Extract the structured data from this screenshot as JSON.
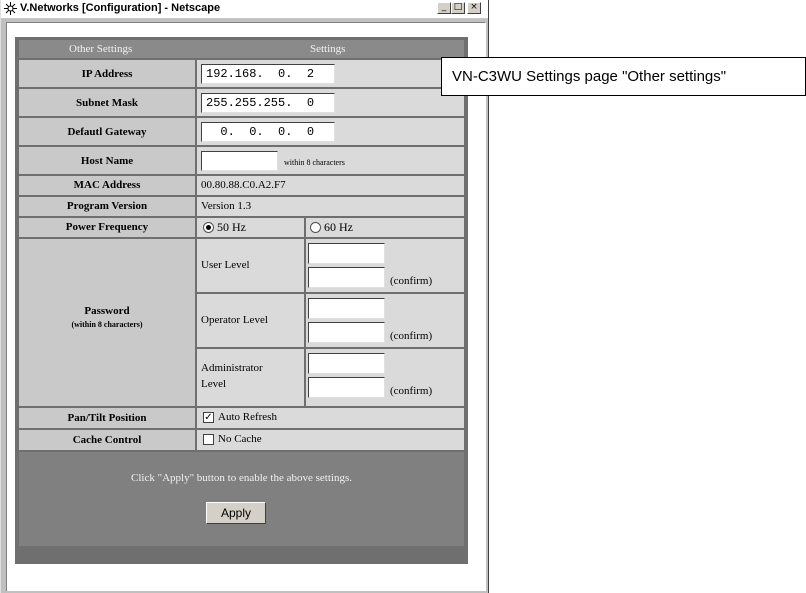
{
  "window": {
    "title": "V.Networks [Configuration] - Netscape",
    "controls": {
      "minimize": "_",
      "maximize": "□",
      "close": "×"
    }
  },
  "table": {
    "header": {
      "left": "Other Settings",
      "right": "Settings"
    },
    "ip_address": {
      "label": "IP Address",
      "value": "192.168.  0.  2"
    },
    "subnet_mask": {
      "label": "Subnet Mask",
      "value": "255.255.255.  0"
    },
    "default_gateway": {
      "label": "Defautl Gateway",
      "value": "  0.  0.  0.  0"
    },
    "host_name": {
      "label": "Host Name",
      "value": "",
      "hint": "within 8 characters"
    },
    "mac_address": {
      "label": "MAC Address",
      "value": "00.80.88.C0.A2.F7"
    },
    "program_version": {
      "label": "Program Version",
      "value": "Version 1.3"
    },
    "power_frequency": {
      "label": "Power Frequency",
      "option1": "50 Hz",
      "option2": "60 Hz",
      "selected": "50 Hz"
    },
    "password": {
      "label": "Password",
      "sublabel": "(within 8 characters)",
      "confirm": "(confirm)",
      "user_level": "User Level",
      "operator_level": "Operator Level",
      "admin_level_line1": "Administrator",
      "admin_level_line2": "Level"
    },
    "pan_tilt": {
      "label": "Pan/Tilt Position",
      "option": "Auto Refresh",
      "checked": true
    },
    "cache_control": {
      "label": "Cache Control",
      "option": "No Cache",
      "checked": false
    },
    "apply_note": "Click \"Apply\" button to enable the above settings.",
    "apply_button": "Apply"
  },
  "callout": "VN-C3WU Settings page \"Other settings\""
}
